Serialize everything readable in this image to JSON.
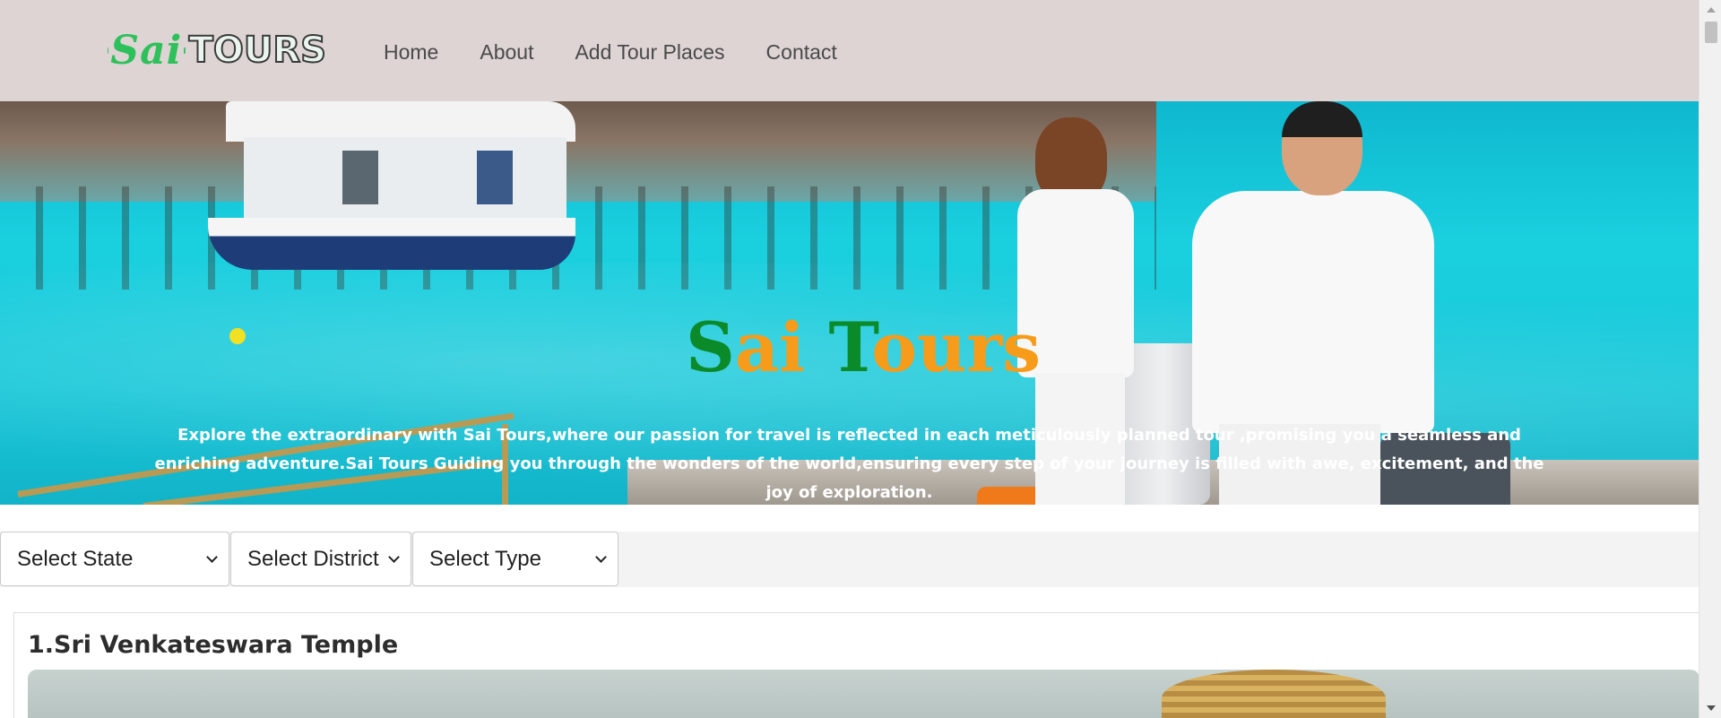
{
  "logo": {
    "text_sai": "Sai",
    "text_tours": "TOURS"
  },
  "nav": {
    "items": [
      {
        "label": "Home"
      },
      {
        "label": "About"
      },
      {
        "label": "Add Tour Places"
      },
      {
        "label": "Contact"
      }
    ]
  },
  "hero": {
    "title_s": "S",
    "title_ai": "ai ",
    "title_t": "T",
    "title_ours": "ours",
    "description": "Explore the extraordinary with Sai Tours,where our passion for travel is reflected in each meticulously planned tour ,promising you a seamless and enriching adventure.Sai Tours Guiding you through the wonders of the world,ensuring every step of your journey is filled with awe, excitement, and the joy of exploration."
  },
  "filters": {
    "state": "Select State",
    "district": "Select District",
    "type": "Select Type"
  },
  "places": [
    {
      "title": "1.Sri Venkateswara Temple"
    }
  ],
  "colors": {
    "header_bg": "#ddd4d3",
    "title_green": "#0b8a2a",
    "title_orange": "#f79b1a"
  }
}
